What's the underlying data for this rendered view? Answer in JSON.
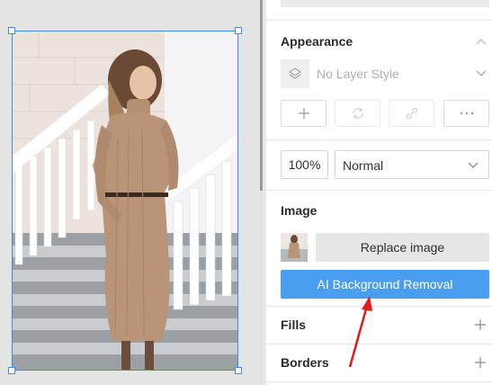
{
  "appearance": {
    "title": "Appearance",
    "layer_style": "No Layer Style",
    "opacity": "100%",
    "blend_mode": "Normal"
  },
  "image": {
    "title": "Image",
    "replace_label": "Replace image",
    "remove_bg_label": "AI Background Removal"
  },
  "fills": {
    "title": "Fills"
  },
  "borders": {
    "title": "Borders"
  },
  "colors": {
    "selection": "#3d8bf2",
    "primary_button": "#4a9ef0",
    "annotation_arrow": "#e8191a"
  },
  "icons": [
    "chevron-up-icon",
    "layers-icon",
    "chevron-down-icon",
    "plus-icon",
    "refresh-icon",
    "link-icon",
    "more-icon",
    "plus-icon"
  ]
}
